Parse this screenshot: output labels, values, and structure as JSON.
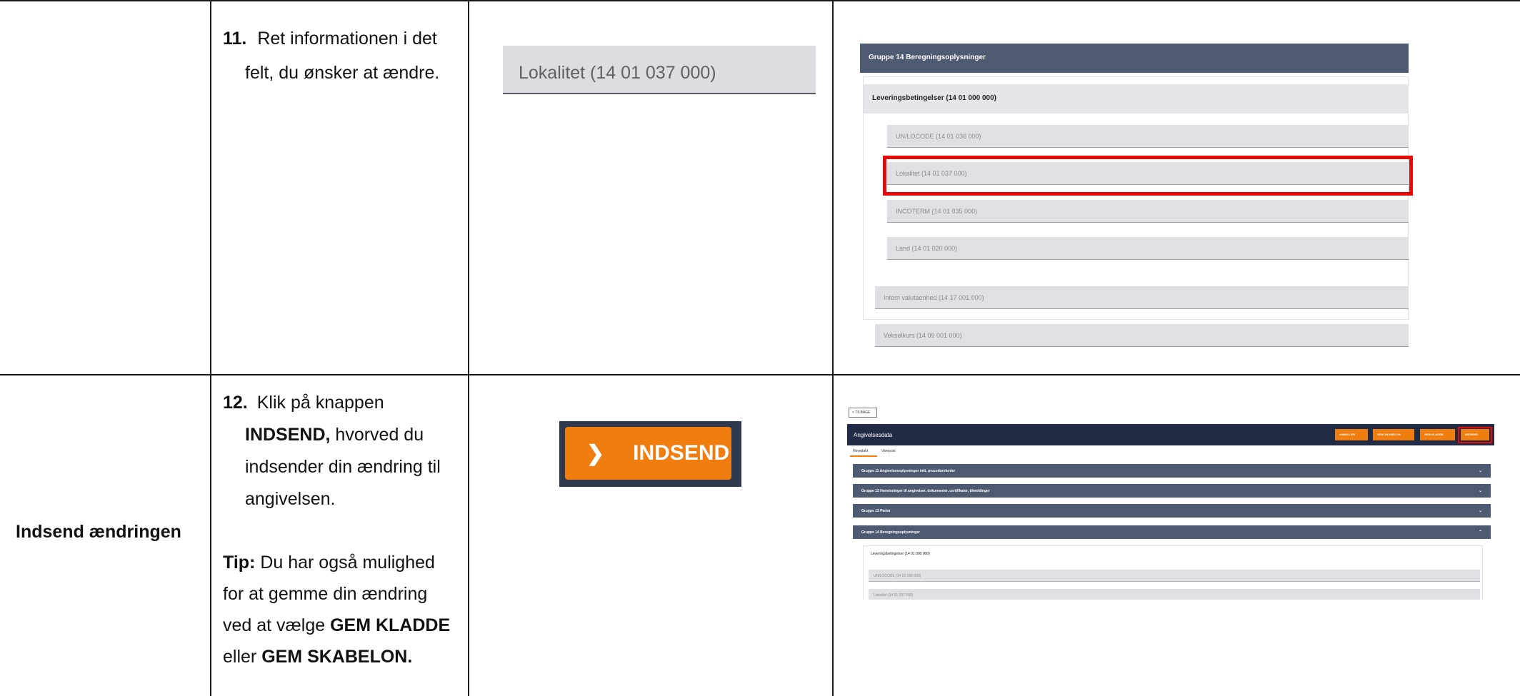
{
  "rows": [
    {
      "title": "",
      "step_number": "11.",
      "step_line1": "Ret informationen i det",
      "step_line2": "felt, du ønsker at ændre.",
      "field_example": "Lokalitet (14 01 037 000)",
      "screenshot": {
        "header": "Gruppe 14 Beregningsoplysninger",
        "subheader": "Leveringsbetingelser (14 01 000 000)",
        "fields": [
          "UN/LOCODE (14 01 036 000)",
          "Lokalitet (14 01 037 000)",
          "INCOTERM (14 01 035 000)",
          "Land (14 01 020 000)"
        ],
        "outer_fields": [
          "Intern valutaenhed (14 17 001 000)",
          "Vekselkurs (14 09 001 000)"
        ]
      }
    },
    {
      "title": "Indsend ændringen",
      "step_number": "12.",
      "step_line1_plain": "Klik på knappen",
      "step_line2_bold": "INDSEND,",
      "step_line2_plain": " hvorved du",
      "step_line3": "indsender din ændring til",
      "step_line4": "angivelsen.",
      "tip_label": "Tip:",
      "tip_line1_rest": " Du har også mulighed",
      "tip_line2": "for at gemme din ændring",
      "tip_line3_plain": "ved at vælge ",
      "tip_line3_bold": "GEM KLADDE",
      "tip_line4_plain": "eller ",
      "tip_line4_bold": "GEM SKABELON.",
      "button_label": "INDSEND",
      "screenshot": {
        "back_label": "TILBAGE",
        "title": "Angivelsesdata",
        "buttons": [
          "ANNULLER",
          "GEM SKABELON",
          "GEM KLADDE",
          "INDSEND"
        ],
        "tabs": [
          "Hovedakt",
          "Varepost"
        ],
        "groups": [
          "Gruppe 11 Angivelsesoplysninger inkl. procedurekoder",
          "Gruppe 12 Henvisninger til angivelser, dokumenter, certifikater, tilmeldinger",
          "Gruppe 13 Parter",
          "Gruppe 14 Beregningsoplysninger"
        ],
        "subheader": "Leveringsbetingelser (14 01 000 000)",
        "fields": [
          "UN/LOCODE (14 01 036 000)",
          "Lokalitet (14 01 037 000)"
        ]
      }
    }
  ],
  "colors": {
    "accent_orange": "#ef7d0f",
    "header_navy": "#4e5a72",
    "highlight_red": "#e40a0a"
  }
}
